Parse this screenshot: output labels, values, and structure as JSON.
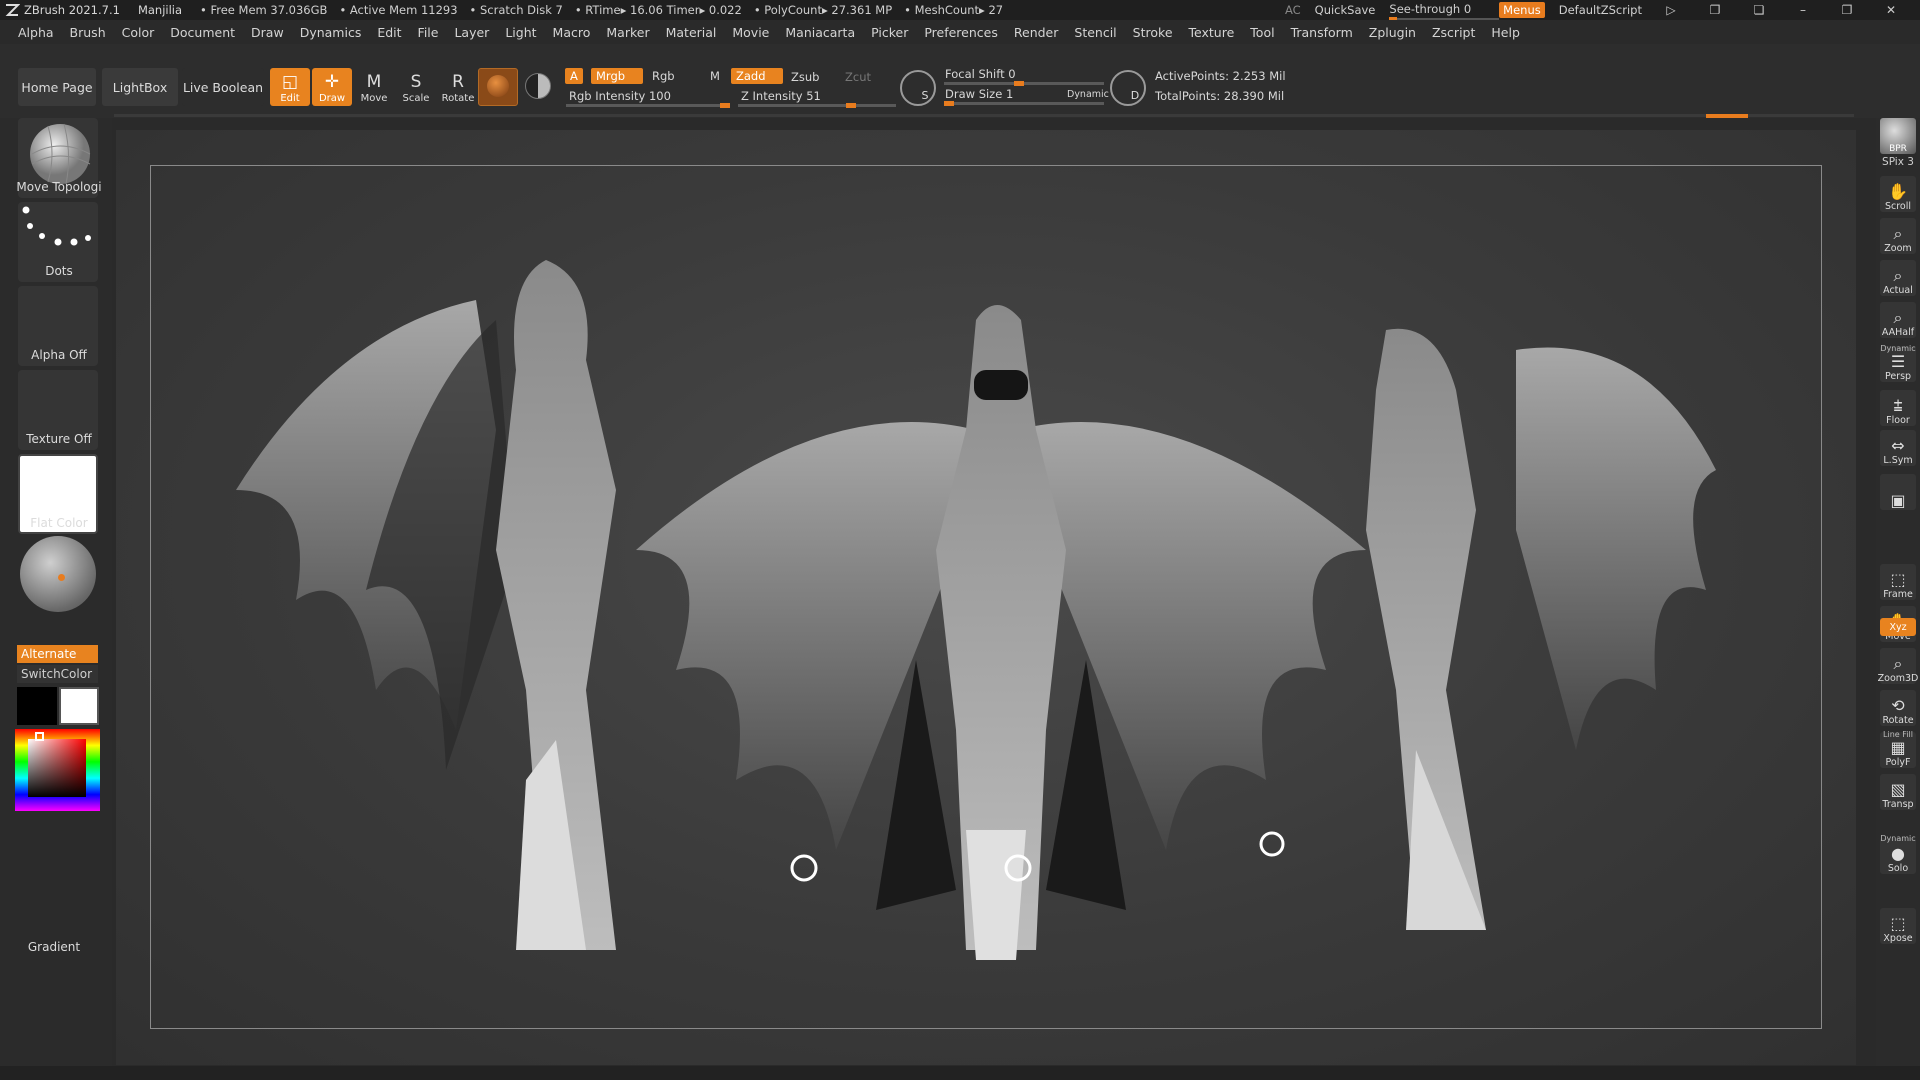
{
  "titlebar": {
    "app": "ZBrush 2021.7.1",
    "user": "Manjilia",
    "stats": [
      "• Free Mem 37.036GB",
      "• Active Mem 11293",
      "• Scratch Disk 7",
      "• RTime▸ 16.06 Timer▸ 0.022",
      "• PolyCount▸ 27.361 MP",
      "• MeshCount▸ 27"
    ],
    "ac": "AC",
    "quicksave": "QuickSave",
    "seethrough": "See-through  0",
    "menus": "Menus",
    "defaultzscript": "DefaultZScript"
  },
  "menubar": [
    "Alpha",
    "Brush",
    "Color",
    "Document",
    "Draw",
    "Dynamics",
    "Edit",
    "File",
    "Layer",
    "Light",
    "Macro",
    "Marker",
    "Material",
    "Movie",
    "Maniacarta",
    "Picker",
    "Preferences",
    "Render",
    "Stencil",
    "Stroke",
    "Texture",
    "Tool",
    "Transform",
    "Zplugin",
    "Zscript",
    "Help"
  ],
  "toolbar": {
    "home_page": "Home Page",
    "lightbox": "LightBox",
    "live_boolean": "Live Boolean",
    "tools": [
      {
        "label": "Edit",
        "icon": "edit-icon",
        "glyph": "◱",
        "on": true
      },
      {
        "label": "Draw",
        "icon": "draw-icon",
        "glyph": "✛",
        "on": true
      },
      {
        "label": "Move",
        "icon": "move-icon",
        "glyph": "M",
        "on": false
      },
      {
        "label": "Scale",
        "icon": "scale-icon",
        "glyph": "S",
        "on": false
      },
      {
        "label": "Rotate",
        "icon": "rotate-icon",
        "glyph": "R",
        "on": false
      }
    ],
    "a": "A",
    "mrgb": "Mrgb",
    "rgb": "Rgb",
    "m": "M",
    "zadd": "Zadd",
    "zsub": "Zsub",
    "zcut": "Zcut",
    "rgb_intensity": "Rgb Intensity 100",
    "z_intensity": "Z Intensity 51",
    "focal_shift": "Focal Shift 0",
    "draw_size": "Draw Size 1",
    "dynamic": "Dynamic",
    "s_label": "S",
    "d_label": "D",
    "active_points": "ActivePoints: 2.253 Mil",
    "total_points": "TotalPoints: 28.390 Mil"
  },
  "leftpanel": {
    "brush": "Move Topologi",
    "stroke": "Dots",
    "alpha": "Alpha Off",
    "texture": "Texture Off",
    "material": "Flat Color",
    "alternate": "Alternate",
    "switchcolor": "SwitchColor",
    "gradient": "Gradient"
  },
  "rightpanel": {
    "bpr": "BPR",
    "spix": "SPix 3",
    "buttons": [
      {
        "label": "Scroll",
        "icon": "scroll-icon",
        "glyph": "✋"
      },
      {
        "label": "Zoom",
        "icon": "zoom-icon",
        "glyph": "⌕"
      },
      {
        "label": "Actual",
        "icon": "actual-icon",
        "glyph": "⌕"
      },
      {
        "label": "AAHalf",
        "icon": "aahalf-icon",
        "glyph": "⌕"
      },
      {
        "label": "Persp",
        "icon": "persp-icon",
        "glyph": "☰"
      },
      {
        "label": "Floor",
        "icon": "floor-icon",
        "glyph": "⩲"
      },
      {
        "label": "L.Sym",
        "icon": "lsym-icon",
        "glyph": "⇔"
      },
      {
        "label": "",
        "icon": "lock-icon",
        "glyph": "▣"
      },
      {
        "label": "Frame",
        "icon": "frame-icon",
        "glyph": "⬚"
      },
      {
        "label": "Move",
        "icon": "move-view-icon",
        "glyph": "✋"
      },
      {
        "label": "Zoom3D",
        "icon": "zoom3d-icon",
        "glyph": "⌕"
      },
      {
        "label": "Rotate",
        "icon": "rotate-view-icon",
        "glyph": "⟲"
      },
      {
        "label": "PolyF",
        "icon": "polyf-icon",
        "glyph": "▦"
      },
      {
        "label": "Transp",
        "icon": "transp-icon",
        "glyph": "▧"
      },
      {
        "label": "Solo",
        "icon": "solo-icon",
        "glyph": "●"
      },
      {
        "label": "Xpose",
        "icon": "xpose-icon",
        "glyph": "⬚"
      }
    ],
    "xyz": "Xyz",
    "persp_top": "Dynamic",
    "polyf_top": "Line Fill",
    "solo_top": "Dynamic"
  },
  "colors": {
    "accent": "#e8831f",
    "bg": "#2a2a2a"
  }
}
